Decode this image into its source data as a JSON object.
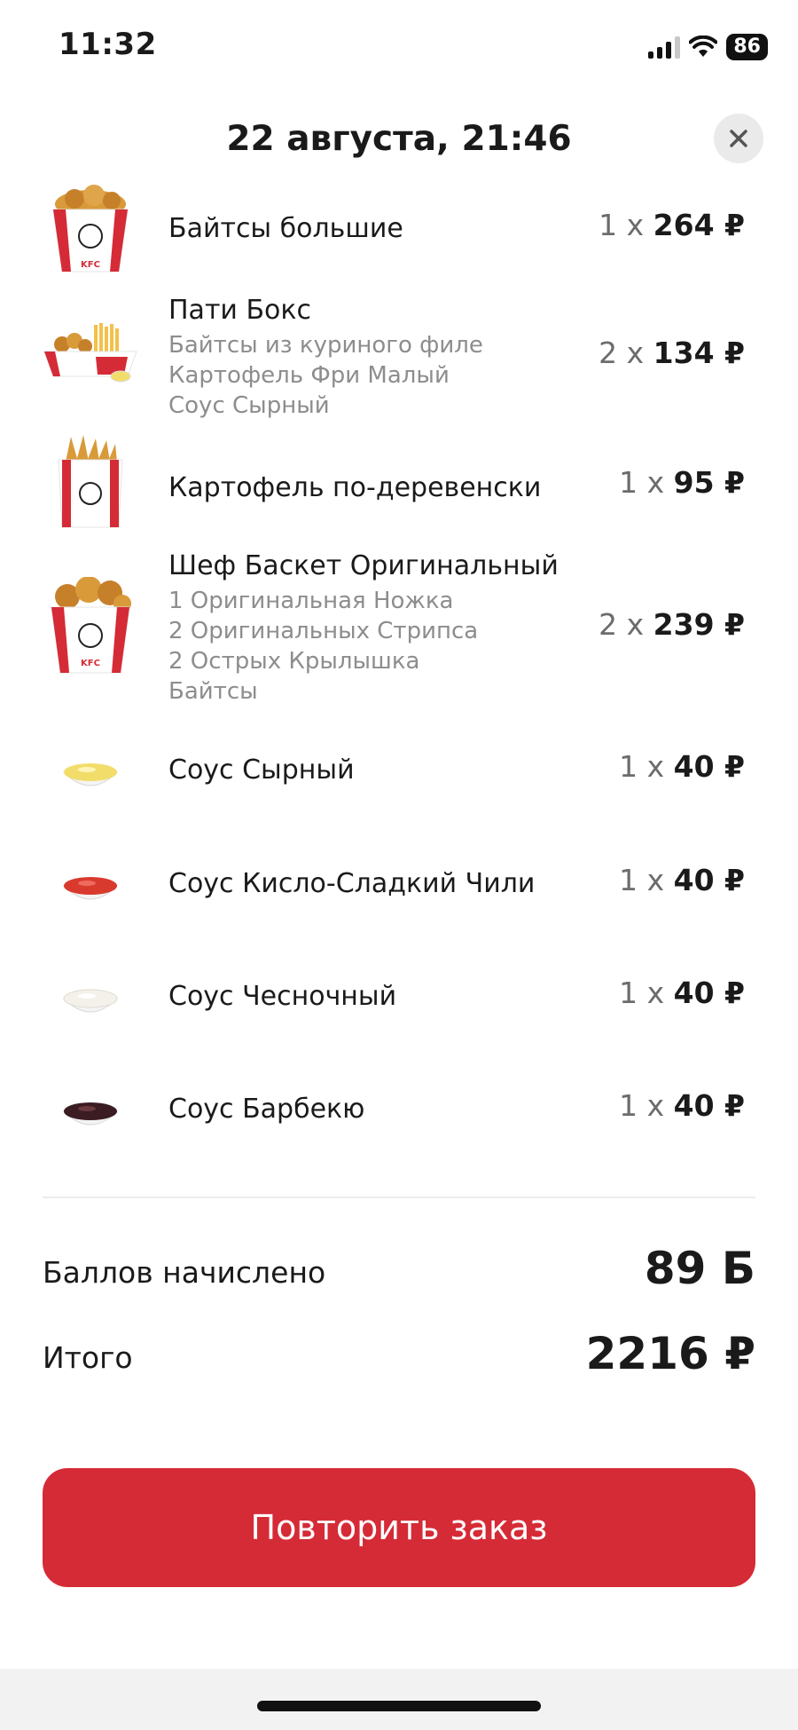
{
  "status_bar": {
    "time": "11:32",
    "battery": "86"
  },
  "header": {
    "title": "22 августа, 21:46"
  },
  "items": [
    {
      "name": "Байтсы большие",
      "subs": [],
      "qty": "1 x",
      "price": "264 ₽",
      "icon": "kfc-bucket"
    },
    {
      "name": "Пати Бокс",
      "subs": [
        "Байтсы из куриного филе",
        "Картофель Фри Малый",
        "Соус Сырный"
      ],
      "qty": "2 x",
      "price": "134 ₽",
      "icon": "party-box"
    },
    {
      "name": "Картофель по-деревенски",
      "subs": [],
      "qty": "1 x",
      "price": "95 ₽",
      "icon": "fries-bag"
    },
    {
      "name": "Шеф Баскет Оригинальный",
      "subs": [
        "1 Оригинальная Ножка",
        "2 Оригинальных Стрипса",
        "2 Острых Крылышка",
        "Байтсы"
      ],
      "qty": "2 x",
      "price": "239 ₽",
      "icon": "kfc-basket"
    },
    {
      "name": "Соус Сырный",
      "subs": [],
      "qty": "1 x",
      "price": "40 ₽",
      "icon": "sauce",
      "color": "#f2dd6b"
    },
    {
      "name": "Соус Кисло-Сладкий Чили",
      "subs": [],
      "qty": "1 x",
      "price": "40 ₽",
      "icon": "sauce",
      "color": "#d93a2e"
    },
    {
      "name": "Соус Чесночный",
      "subs": [],
      "qty": "1 x",
      "price": "40 ₽",
      "icon": "sauce",
      "color": "#f3f1ea"
    },
    {
      "name": "Соус Барбекю",
      "subs": [],
      "qty": "1 x",
      "price": "40 ₽",
      "icon": "sauce",
      "color": "#3a1c22"
    }
  ],
  "summary": {
    "points_label": "Баллов начислено",
    "points_value": "89 Б",
    "total_label": "Итого",
    "total_value": "2216 ₽"
  },
  "actions": {
    "repeat_label": "Повторить заказ"
  },
  "colors": {
    "accent": "#d52b36"
  }
}
